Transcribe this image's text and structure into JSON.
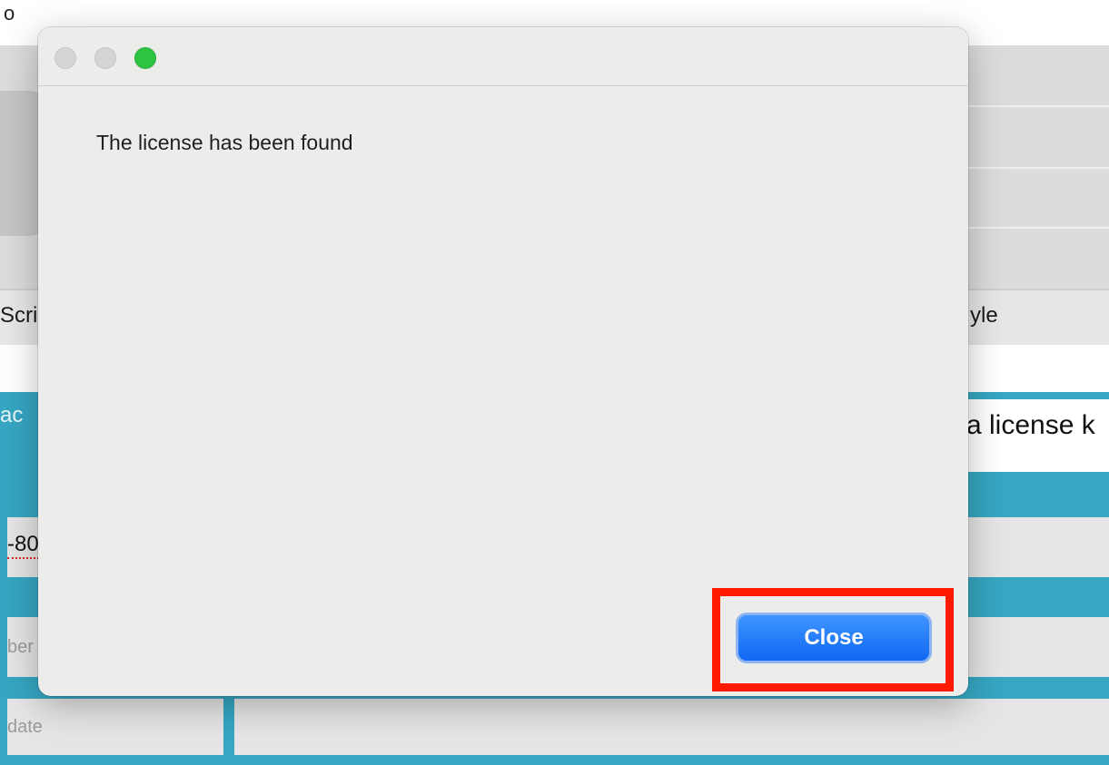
{
  "background_app": {
    "top_fragment": "o",
    "row_left_fragment": "Scri",
    "row_right_fragment": "yle",
    "teal_left_fragment": "ac",
    "teal_right_fragment": "a license k",
    "number_fragment": "-80",
    "field_fragment_1": "ber",
    "field_fragment_2": "date",
    "accent_color": "#36a6c2"
  },
  "dialog": {
    "window_controls": [
      "close-disabled",
      "minimize-disabled",
      "zoom"
    ],
    "message": "The license has been found",
    "close_label": "Close",
    "button_color": "#1a73f4",
    "highlight_color": "#ff1a00"
  }
}
